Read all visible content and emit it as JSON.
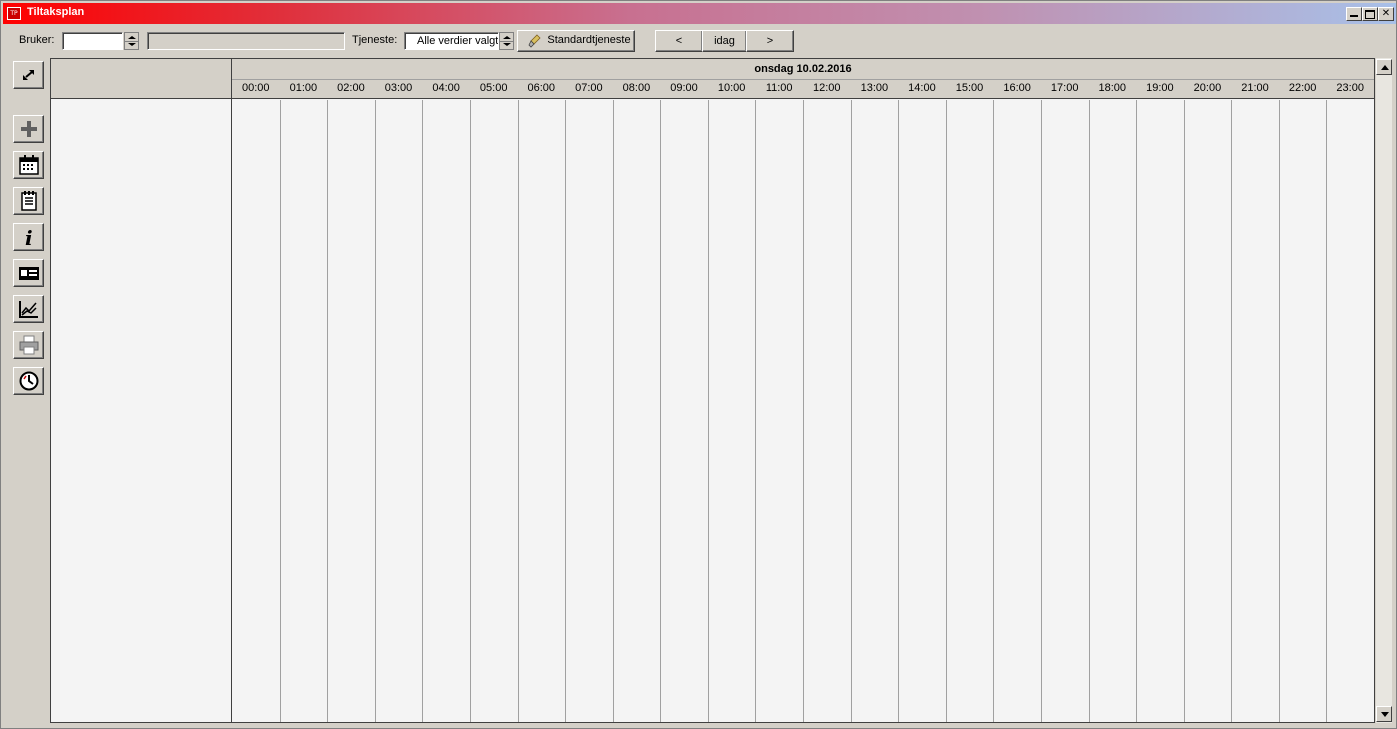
{
  "window": {
    "title": "Tiltaksplan",
    "app_icon": "app-icon"
  },
  "toolbar": {
    "bruker_label": "Bruker:",
    "bruker_value": "",
    "bruker_name": "",
    "tjeneste_label": "Tjeneste:",
    "tjeneste_value": "Alle verdier valgt",
    "standard_button": "Standardtjeneste",
    "prev_button": "<",
    "today_button": "idag",
    "next_button": ">"
  },
  "sidebar": {
    "buttons": [
      "expand-icon",
      "add-icon",
      "calendar-icon",
      "notepad-icon",
      "info-icon",
      "card-icon",
      "chart-icon",
      "print-icon",
      "clock-icon"
    ]
  },
  "schedule": {
    "date": "onsdag 10.02.2016",
    "hours": [
      "00:00",
      "01:00",
      "02:00",
      "03:00",
      "04:00",
      "05:00",
      "06:00",
      "07:00",
      "08:00",
      "09:00",
      "10:00",
      "11:00",
      "12:00",
      "13:00",
      "14:00",
      "15:00",
      "16:00",
      "17:00",
      "18:00",
      "19:00",
      "20:00",
      "21:00",
      "22:00",
      "23:00"
    ]
  }
}
